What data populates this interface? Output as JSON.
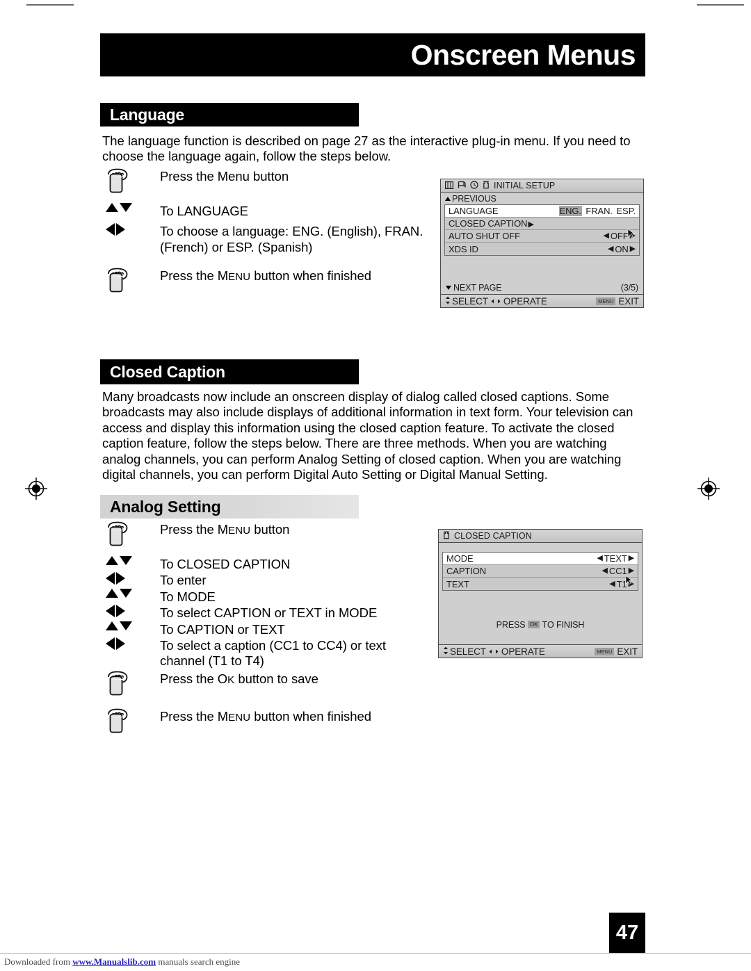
{
  "page": {
    "header_title": "Onscreen Menus",
    "page_number": "47"
  },
  "footer": {
    "prefix": "Downloaded from ",
    "link": "www.Manualslib.com",
    "suffix": " manuals search engine"
  },
  "sections": {
    "language": {
      "heading": "Language",
      "paragraph": "The language function is described on page 27 as the interactive plug-in menu. If you need to choose the language again, follow the steps below.",
      "steps": [
        {
          "icon": "press-button-icon",
          "text_html": "Press the Menu button"
        },
        {
          "icon": "up-down-arrows-icon",
          "text_html": "To LANGUAGE"
        },
        {
          "icon": "left-right-arrows-icon",
          "text_html": "To choose a language: ENG. (English), FRAN. (French) or ESP. (Spanish)"
        },
        {
          "icon": "press-button-icon",
          "text_html": "Press the MENU button when finished"
        }
      ]
    },
    "closed_caption": {
      "heading": "Closed Caption",
      "paragraph": "Many broadcasts now include an onscreen display of dialog called closed captions. Some broadcasts may also include displays of additional information in text form. Your television can access and display this information using the closed caption feature. To activate the closed caption feature, follow the steps below.  There are three methods.  When you are watching analog channels, you can perform Analog Setting of closed caption.  When you are watching digital channels, you can perform Digital Auto Setting or Digital Manual Setting."
    },
    "analog_setting": {
      "heading": "Analog Setting",
      "steps": [
        {
          "icon": "press-button-icon",
          "text_html": "Press the MENU button"
        },
        {
          "icon": "up-down-arrows-icon",
          "text_html": "To CLOSED CAPTION"
        },
        {
          "icon": "left-right-arrows-icon",
          "text_html": "To enter"
        },
        {
          "icon": "up-down-arrows-icon",
          "text_html": "To MODE"
        },
        {
          "icon": "left-right-arrows-icon",
          "text_html": "To select CAPTION or TEXT in MODE"
        },
        {
          "icon": "up-down-arrows-icon",
          "text_html": "To CAPTION or TEXT"
        },
        {
          "icon": "left-right-arrows-icon",
          "text_html": "To select a caption (CC1 to CC4) or text channel (T1 to T4)"
        },
        {
          "icon": "press-button-icon",
          "text_html": "Press the OK button to save"
        },
        {
          "icon": "press-button-icon",
          "text_html": "Press the MENU button when finished"
        }
      ]
    }
  },
  "osd_initial_setup": {
    "title": "INITIAL SETUP",
    "title_icons": [
      "picture-icon",
      "flag-icon",
      "clock-icon",
      "setup-icon"
    ],
    "previous_label": "PREVIOUS",
    "rows": [
      {
        "label": "LANGUAGE",
        "value": "ENG. FRAN. ESP.",
        "highlight": "ENG.",
        "selected": true,
        "carets": false
      },
      {
        "label": "CLOSED CAPTION",
        "value": "",
        "highlight": "",
        "selected": false,
        "carets": false,
        "submenu": true
      },
      {
        "label": "AUTO SHUT OFF",
        "value": "OFF",
        "highlight": "",
        "selected": false,
        "carets": true
      },
      {
        "label": "XDS ID",
        "value": "ON",
        "highlight": "",
        "selected": false,
        "carets": true
      }
    ],
    "next_page_label": "NEXT PAGE",
    "page_indicator": "(3/5)",
    "bottom_select": "SELECT",
    "bottom_operate": "OPERATE",
    "bottom_menu_key": "MENU",
    "bottom_exit": "EXIT"
  },
  "osd_closed_caption": {
    "title": "CLOSED CAPTION",
    "title_icons": [
      "setup-icon"
    ],
    "rows": [
      {
        "label": "MODE",
        "value": "TEXT",
        "selected": true,
        "carets": true
      },
      {
        "label": "CAPTION",
        "value": "CC1",
        "selected": false,
        "carets": true
      },
      {
        "label": "TEXT",
        "value": "T1",
        "selected": false,
        "carets": true
      }
    ],
    "finish_prefix": "PRESS",
    "finish_key": "OK",
    "finish_suffix": "TO FINISH",
    "bottom_select": "SELECT",
    "bottom_operate": "OPERATE",
    "bottom_menu_key": "MENU",
    "bottom_exit": "EXIT"
  }
}
